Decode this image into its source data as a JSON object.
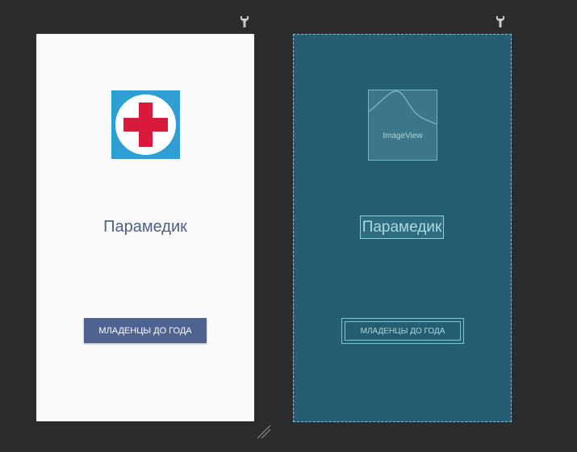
{
  "design": {
    "icon": "medical-cross-icon",
    "title": "Парамедик",
    "button_label": "МЛАДЕНЦЫ ДО ГОДА"
  },
  "blueprint": {
    "image_placeholder_label": "ImageView",
    "title": "Парамедик",
    "button_label": "МЛАДЕНЦЫ ДО ГОДА"
  },
  "icons": {
    "device_settings": "wrench-icon",
    "resize": "resize-handle-icon"
  },
  "colors": {
    "canvas_background": "#2b2c2e",
    "design_background": "#fafafa",
    "blueprint_background": "#255e72",
    "button_primary": "#4f6290",
    "cross_red": "#d91a3c",
    "icon_blue": "#2f9ed5"
  }
}
